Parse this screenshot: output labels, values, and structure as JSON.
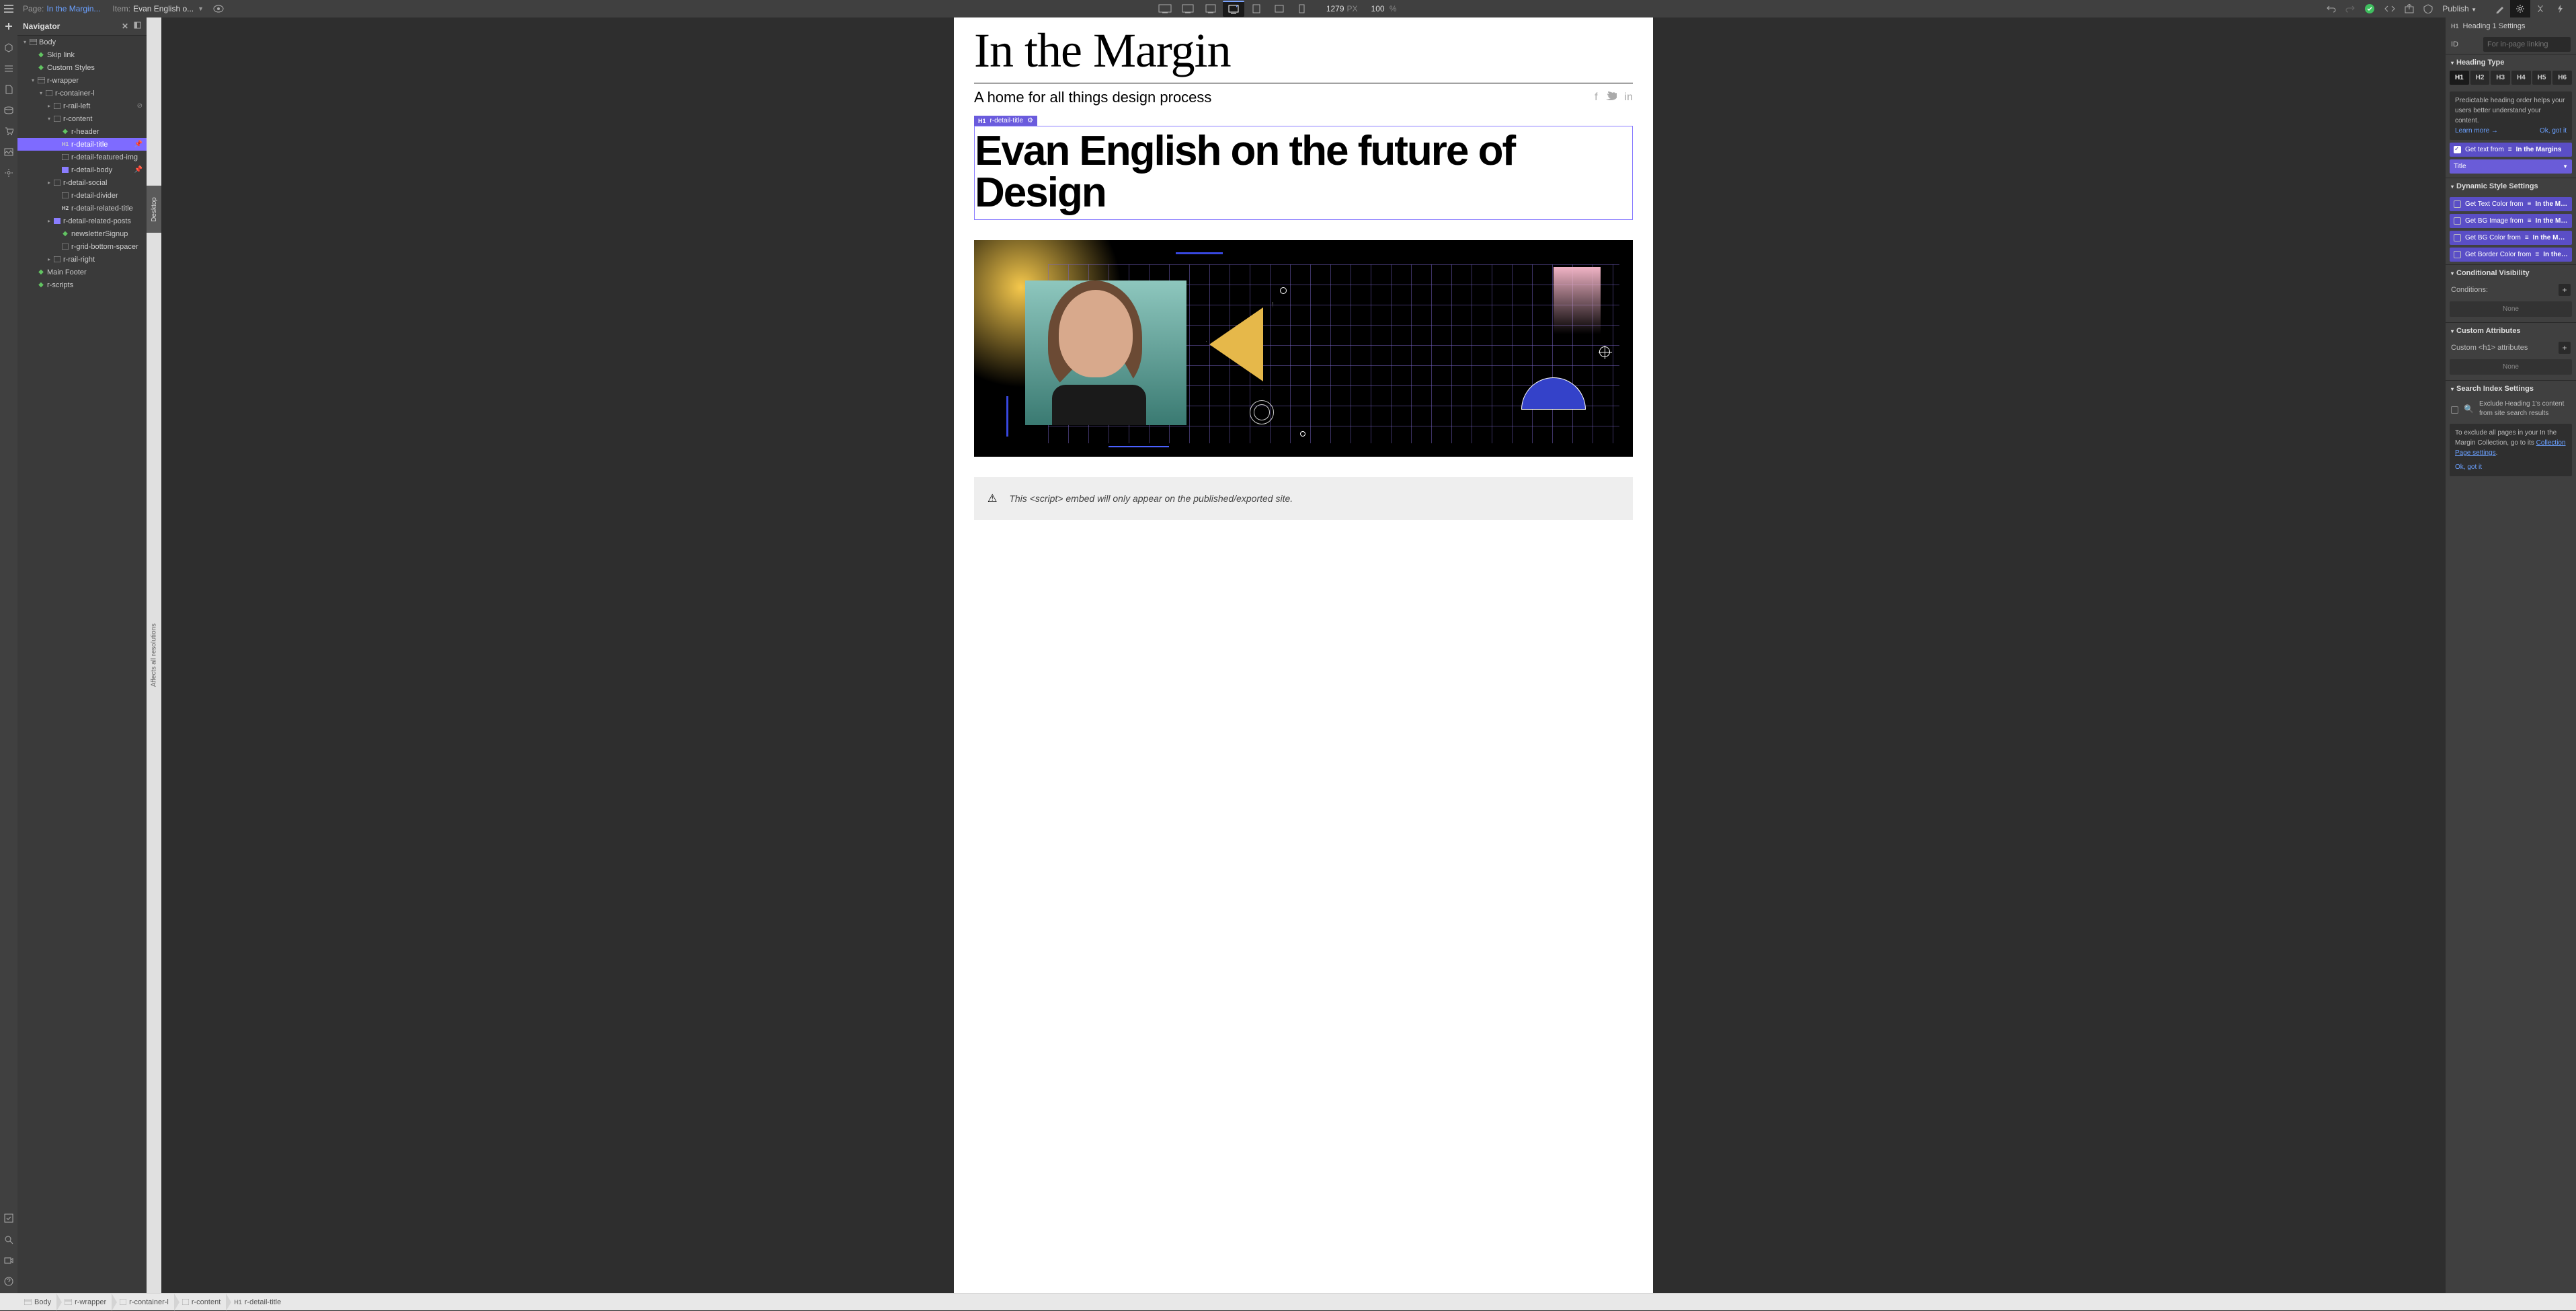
{
  "topbar": {
    "page_label": "Page:",
    "page_value": "In the Margin...",
    "item_label": "Item:",
    "item_value": "Evan English o...",
    "width": "1279",
    "width_unit": "PX",
    "zoom": "100",
    "zoom_unit": "%",
    "publish": "Publish"
  },
  "navigator": {
    "title": "Navigator",
    "tree": [
      {
        "indent": 0,
        "caret": "open",
        "icon": "sect",
        "label": "Body"
      },
      {
        "indent": 1,
        "caret": "none",
        "icon": "green",
        "label": "Skip link"
      },
      {
        "indent": 1,
        "caret": "none",
        "icon": "green",
        "label": "Custom Styles"
      },
      {
        "indent": 1,
        "caret": "open",
        "icon": "sect",
        "label": "r-wrapper"
      },
      {
        "indent": 2,
        "caret": "open",
        "icon": "div",
        "label": "r-container-l"
      },
      {
        "indent": 3,
        "caret": "closed",
        "icon": "div",
        "label": "r-rail-left",
        "extra": "eye-off"
      },
      {
        "indent": 3,
        "caret": "open",
        "icon": "div",
        "label": "r-content"
      },
      {
        "indent": 4,
        "caret": "none",
        "icon": "green",
        "label": "r-header"
      },
      {
        "indent": 4,
        "caret": "none",
        "icon": "h1",
        "label": "r-detail-title",
        "selected": true,
        "extra": "pin"
      },
      {
        "indent": 4,
        "caret": "none",
        "icon": "div",
        "label": "r-detail-featured-img"
      },
      {
        "indent": 4,
        "caret": "none",
        "icon": "purple",
        "label": "r-detail-body",
        "extra": "pin"
      },
      {
        "indent": 3,
        "caret": "closed",
        "icon": "div",
        "label": "r-detail-social"
      },
      {
        "indent": 4,
        "caret": "none",
        "icon": "div",
        "label": "r-detail-divider"
      },
      {
        "indent": 4,
        "caret": "none",
        "icon": "h2",
        "label": "r-detail-related-title"
      },
      {
        "indent": 3,
        "caret": "closed",
        "icon": "purple",
        "label": "r-detail-related-posts"
      },
      {
        "indent": 4,
        "caret": "none",
        "icon": "green",
        "label": "newsletterSignup"
      },
      {
        "indent": 4,
        "caret": "none",
        "icon": "div",
        "label": "r-grid-bottom-spacer"
      },
      {
        "indent": 3,
        "caret": "closed",
        "icon": "div",
        "label": "r-rail-right"
      },
      {
        "indent": 1,
        "caret": "none",
        "icon": "green",
        "label": "Main Footer"
      },
      {
        "indent": 1,
        "caret": "none",
        "icon": "green",
        "label": "r-scripts"
      }
    ]
  },
  "vhandle": {
    "affects": "Affects all resolutions",
    "tab": "Desktop"
  },
  "page_content": {
    "site_title": "In the Margin",
    "subtitle": "A home for all things design process",
    "selected_tag": "H1",
    "selected_name": "r-detail-title",
    "detail_title": "Evan English on the future of Design",
    "script_notice": "This <script> embed will only appear on the published/exported site."
  },
  "right_panel": {
    "title_tag": "H1",
    "title": "Heading 1 Settings",
    "id_label": "ID",
    "id_placeholder": "For in-page linking",
    "heading_type": "Heading Type",
    "heading_buttons": [
      "H1",
      "H2",
      "H3",
      "H4",
      "H5",
      "H6"
    ],
    "heading_info": "Predictable heading order helps your users better understand your content.",
    "learn_more": "Learn more →",
    "ok_got_it": "Ok, got it",
    "get_text_from": "Get text from",
    "collection_name": "In the Margins",
    "field_select": "Title",
    "dynamic_style": "Dynamic Style Settings",
    "dyn_rows": [
      {
        "label": "Get Text Color from",
        "coll": "In the Mar..."
      },
      {
        "label": "Get BG Image from",
        "coll": "In the Marg..."
      },
      {
        "label": "Get BG Color from",
        "coll": "In the Margi..."
      },
      {
        "label": "Get Border Color from",
        "coll": "In the M..."
      }
    ],
    "cond_vis": "Conditional Visibility",
    "conditions_label": "Conditions:",
    "none": "None",
    "custom_attr": "Custom Attributes",
    "custom_attr_label": "Custom <h1> attributes",
    "search_idx": "Search Index Settings",
    "exclude_text": "Exclude Heading 1's content from site search results",
    "exclude_info_1": "To exclude all pages in your In the Margin Collection, go to its ",
    "exclude_info_link": "Collection Page settings",
    "exclude_info_2": "."
  },
  "breadcrumb": [
    {
      "icon": "sect",
      "label": "Body"
    },
    {
      "icon": "sect",
      "label": "r-wrapper"
    },
    {
      "icon": "div",
      "label": "r-container-l"
    },
    {
      "icon": "div",
      "label": "r-content"
    },
    {
      "tag": "H1",
      "label": "r-detail-title"
    }
  ]
}
